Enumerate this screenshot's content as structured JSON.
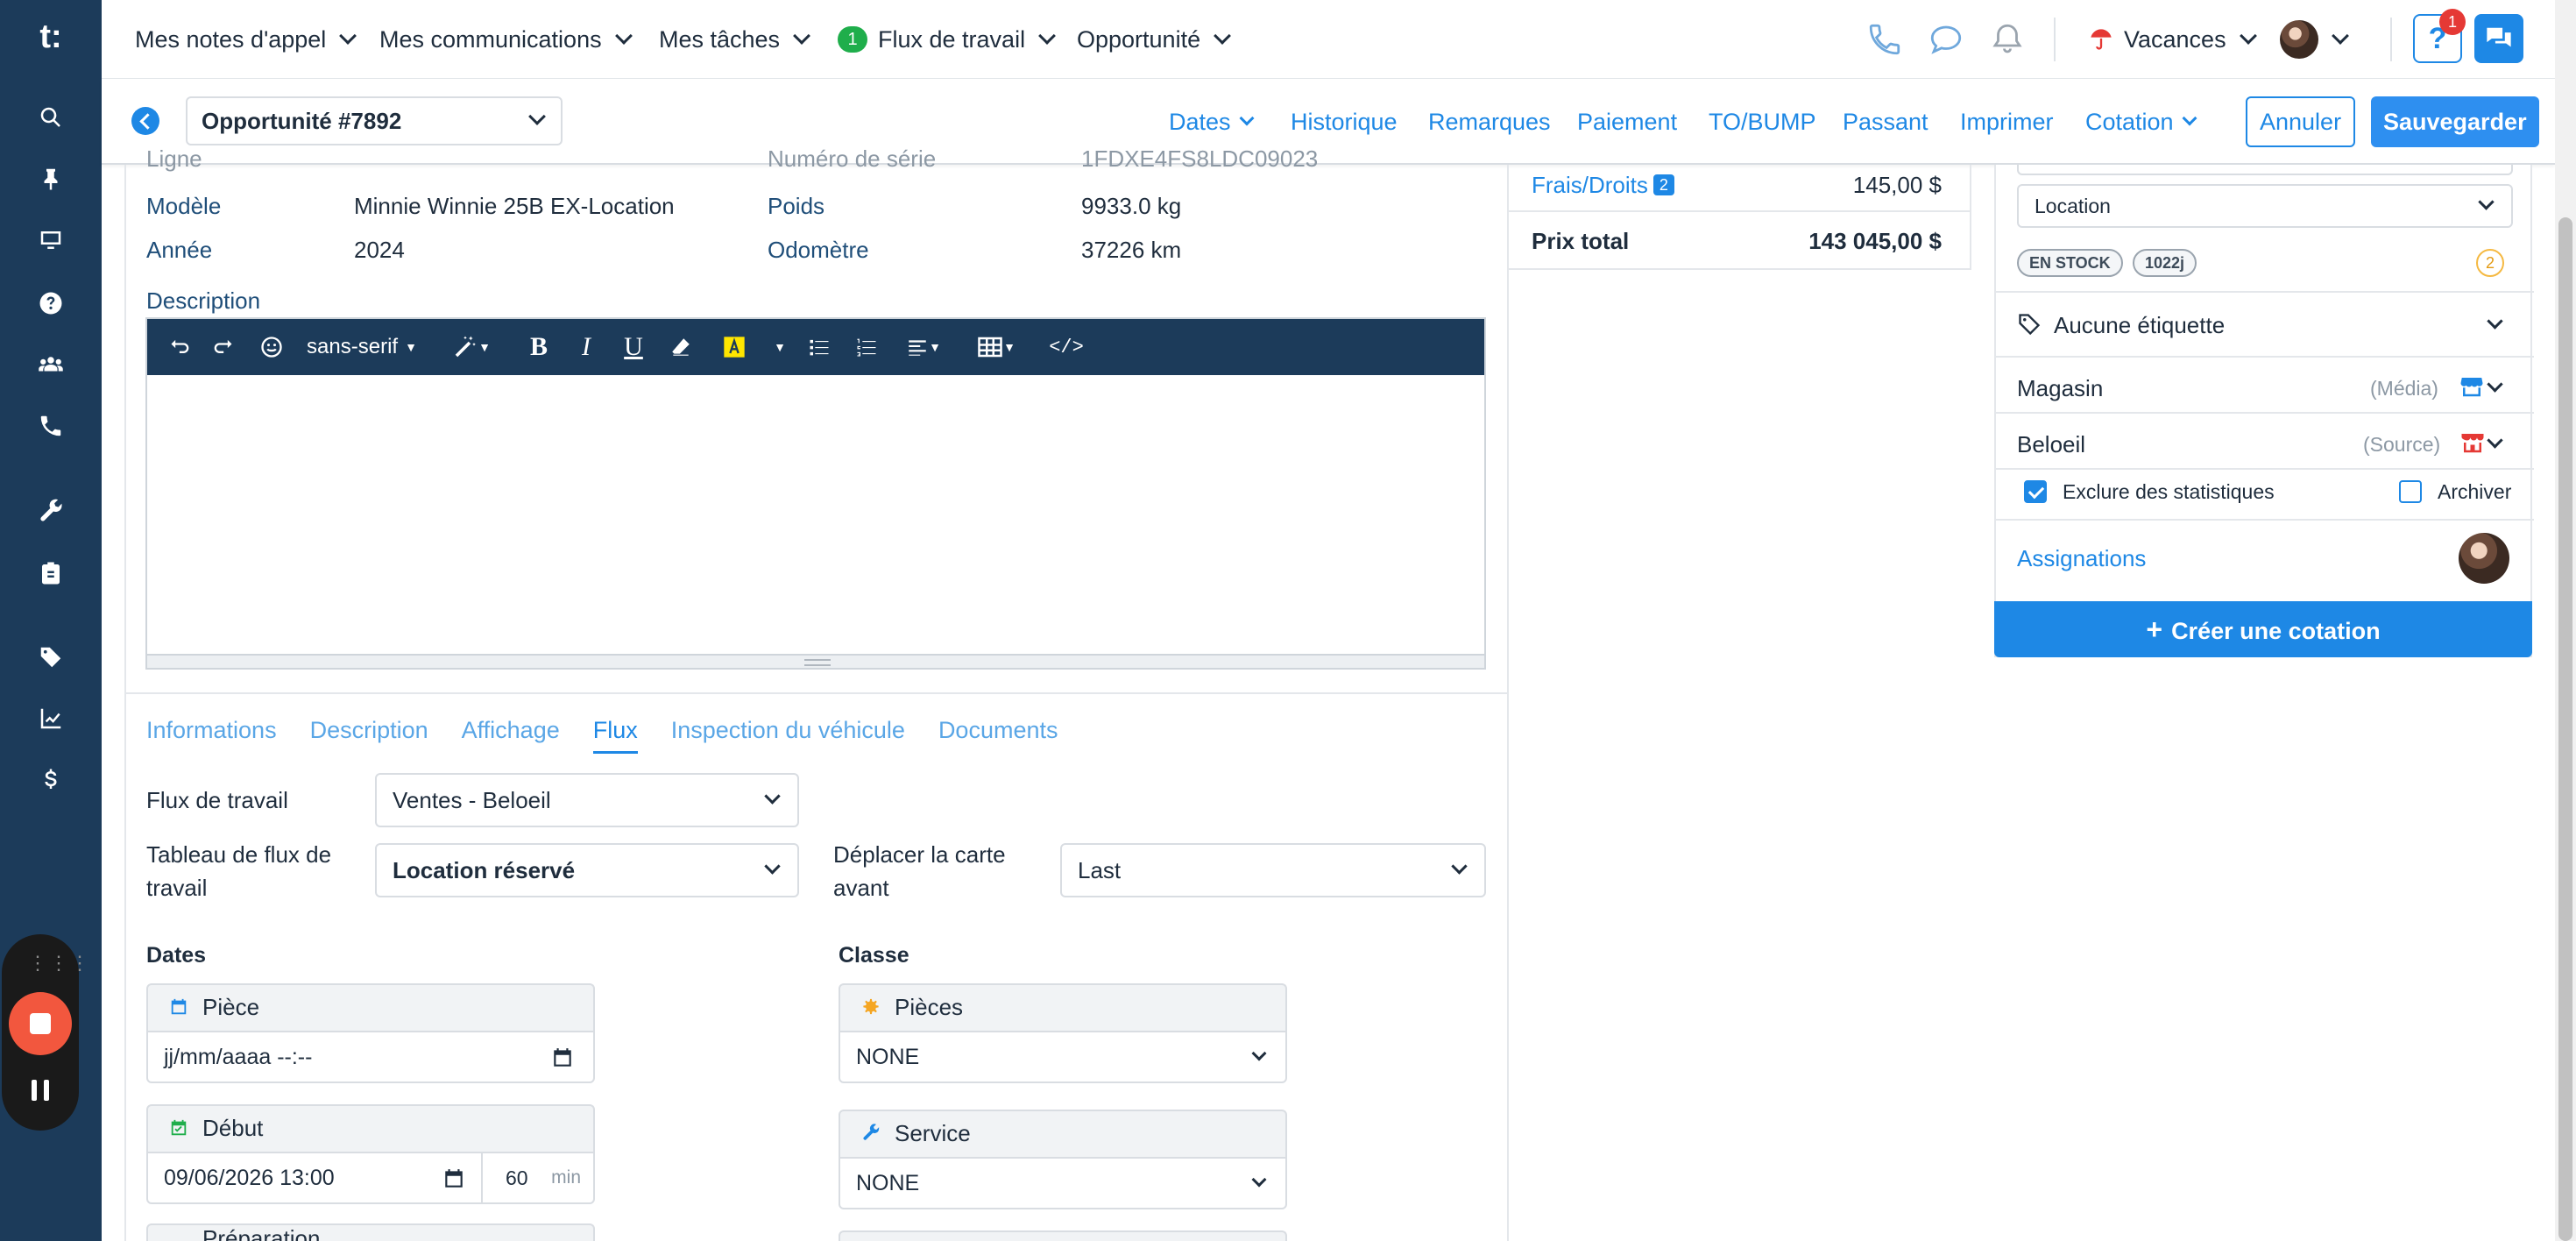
{
  "colors": {
    "primary": "#1e88e5",
    "rail": "#1c3b5a",
    "success": "#1fae4b",
    "danger": "#e53935",
    "record": "#f2573e"
  },
  "rail": {
    "logo": "t:",
    "icons": [
      "search-icon",
      "pin-icon",
      "monitor-icon",
      "help-circle-icon",
      "users-icon",
      "phone-icon",
      "wrench-icon",
      "clipboard-icon",
      "tag-icon",
      "chart-icon",
      "dollar-icon"
    ]
  },
  "topnav": {
    "menus": [
      {
        "label": "Mes notes d'appel"
      },
      {
        "label": "Mes communications"
      },
      {
        "label": "Mes tâches"
      },
      {
        "label": "Flux de travail",
        "badge": "1"
      },
      {
        "label": "Opportunité"
      }
    ],
    "vacation_label": "Vacances",
    "help_label": "?",
    "notification_count": "1"
  },
  "subbar": {
    "opportunity": "Opportunité #7892",
    "links": [
      "Dates",
      "Historique",
      "Remarques",
      "Paiement",
      "TO/BUMP",
      "Passant",
      "Imprimer",
      "Cotation"
    ],
    "cancel_label": "Annuler",
    "save_label": "Sauvegarder"
  },
  "vehicle": {
    "cut_label_left": "Ligne",
    "cut_label_right": "Numéro de série",
    "cut_value_right": "1FDXE4FS8LDC09023",
    "model_label": "Modèle",
    "model_value": "Minnie Winnie 25B EX-Location",
    "weight_label": "Poids",
    "weight_value": "9933.0 kg",
    "year_label": "Année",
    "year_value": "2024",
    "odometer_label": "Odomètre",
    "odometer_value": "37226 km",
    "description_label": "Description"
  },
  "editor": {
    "font_label": "sans-serif"
  },
  "tabs": {
    "items": [
      "Informations",
      "Description",
      "Affichage",
      "Flux",
      "Inspection du véhicule",
      "Documents"
    ],
    "active": "Flux"
  },
  "flux": {
    "workflow_label": "Flux de travail",
    "workflow_value": "Ventes - Beloeil",
    "board_label": "Tableau de flux de travail",
    "board_value": "Location réservé",
    "move_label": "Déplacer la carte avant",
    "move_value": "Last",
    "dates_title": "Dates",
    "class_title": "Classe",
    "piece_label": "Pièce",
    "piece_placeholder": "jj/mm/aaaa --:--",
    "debut_label": "Début",
    "debut_value": "09/06/2026 13:00",
    "duration_value": "60",
    "duration_unit": "min",
    "cut_card_label": "Préparation",
    "pieces_label": "Pièces",
    "pieces_value": "NONE",
    "service_label": "Service",
    "service_value": "NONE"
  },
  "totals": {
    "fees_label": "Frais/Droits",
    "fees_badge": "2",
    "fees_value": "145,00 $",
    "total_label": "Prix total",
    "total_value": "143 045,00 $"
  },
  "panel": {
    "type_value": "Location",
    "stock_pill": "EN STOCK",
    "days_pill": "1022j",
    "count_badge": "2",
    "tag_label": "Aucune étiquette",
    "media_label": "Magasin",
    "media_hint": "(Média)",
    "source_label": "Beloeil",
    "source_hint": "(Source)",
    "exclude_label": "Exclure des statistiques",
    "exclude_checked": true,
    "archive_label": "Archiver",
    "archive_checked": false,
    "assign_label": "Assignations",
    "create_label": "Créer une cotation"
  }
}
